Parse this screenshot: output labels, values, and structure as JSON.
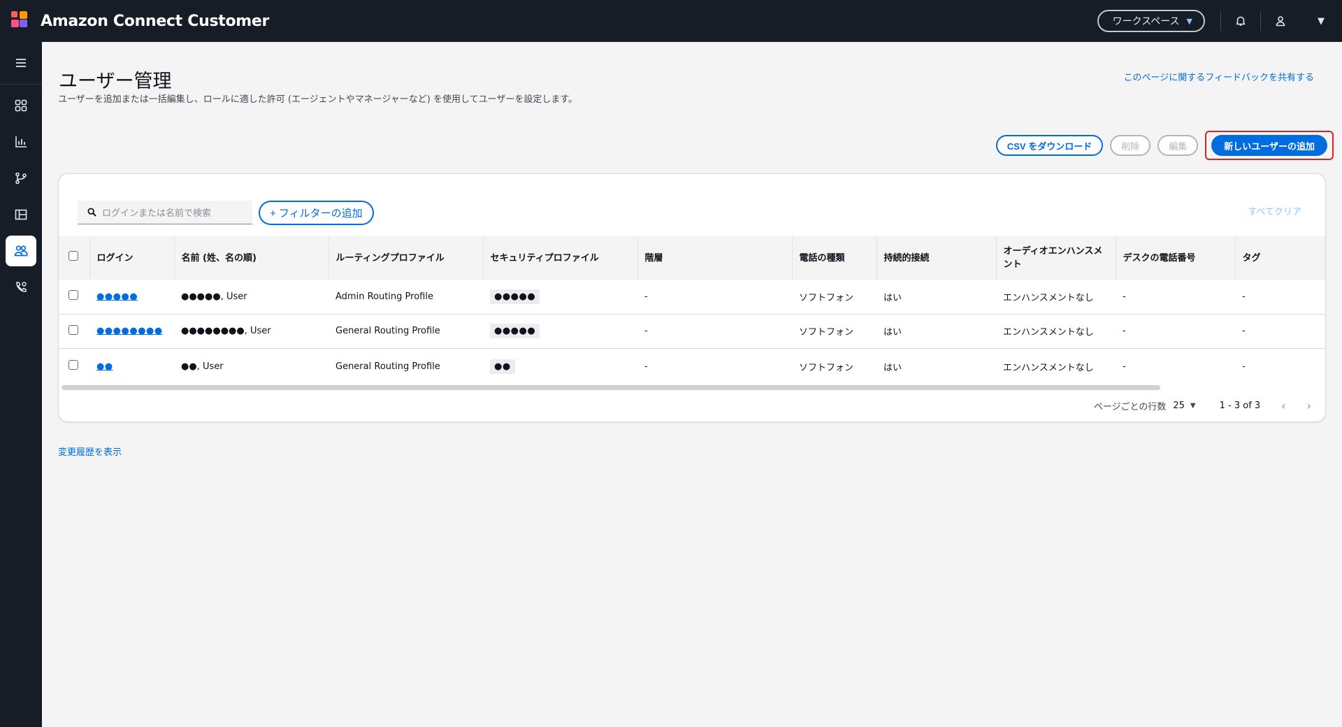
{
  "app": {
    "name": "Amazon Connect Customer",
    "logo_colors": [
      "#ff4f8b",
      "#ff9900",
      "#7b61ff",
      "#ff5c5c"
    ]
  },
  "topbar": {
    "workspace_label": "ワークスペース",
    "icons": [
      "bell-icon",
      "user-icon",
      "caret-down-icon"
    ]
  },
  "rail": {
    "items": [
      "menu-icon",
      "grid-icon",
      "bar-chart-icon",
      "flow-icon",
      "table-layout-icon",
      "users-icon",
      "phone-settings-icon"
    ],
    "active": "users-icon"
  },
  "page": {
    "title": "ユーザー管理",
    "description": "ユーザーを追加または一括編集し、ロールに適した許可 (エージェントやマネージャーなど) を使用してユーザーを設定します。",
    "feedback_link": "このページに関するフィードバックを共有する"
  },
  "actions": {
    "download_csv": "CSV をダウンロード",
    "delete": "削除",
    "edit": "編集",
    "add_user": "新しいユーザーの追加"
  },
  "filters": {
    "search_placeholder": "ログインまたは名前で検索",
    "add_filter": "+ フィルターの追加",
    "clear_all": "すべてクリア"
  },
  "table": {
    "columns": [
      "ログイン",
      "名前 (姓、名の順)",
      "ルーティングプロファイル",
      "セキュリティプロファイル",
      "階層",
      "電話の種類",
      "持続的接続",
      "オーディオエンハンスメント",
      "デスクの電話番号",
      "タグ"
    ],
    "rows": [
      {
        "login": "●●●●●",
        "name": "●●●●●, User",
        "routing": "Admin Routing Profile",
        "security": "●●●●●",
        "hierarchy": "-",
        "phone_type": "ソフトフォン",
        "persistent": "はい",
        "audio": "エンハンスメントなし",
        "desk_phone": "-",
        "tags": "-"
      },
      {
        "login": "●●●●●●●●",
        "name": "●●●●●●●●, User",
        "routing": "General Routing Profile",
        "security": "●●●●●",
        "hierarchy": "-",
        "phone_type": "ソフトフォン",
        "persistent": "はい",
        "audio": "エンハンスメントなし",
        "desk_phone": "-",
        "tags": "-"
      },
      {
        "login": "●●",
        "name": "●●, User",
        "routing": "General Routing Profile",
        "security": "●●",
        "hierarchy": "-",
        "phone_type": "ソフトフォン",
        "persistent": "はい",
        "audio": "エンハンスメントなし",
        "desk_phone": "-",
        "tags": "-"
      }
    ]
  },
  "pagination": {
    "rows_per_page_label": "ページごとの行数",
    "rows_per_page": "25",
    "range": "1 - 3 of 3"
  },
  "footer": {
    "history_link": "変更履歴を表示"
  }
}
